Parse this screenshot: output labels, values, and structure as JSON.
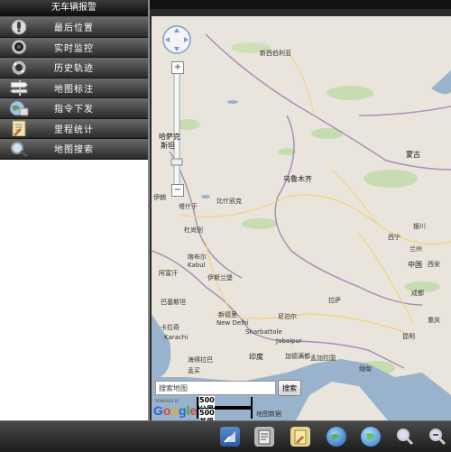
{
  "sidebar": {
    "title": "无车辆报警",
    "items": [
      {
        "label": "最后位置",
        "icon": "pin-icon"
      },
      {
        "label": "实时监控",
        "icon": "camera-icon"
      },
      {
        "label": "历史轨迹",
        "icon": "film-icon"
      },
      {
        "label": "地图标注",
        "icon": "signpost-icon"
      },
      {
        "label": "指令下发",
        "icon": "globe-icon"
      },
      {
        "label": "里程统计",
        "icon": "document-icon"
      },
      {
        "label": "地图搜索",
        "icon": "magnifier-icon"
      }
    ]
  },
  "map": {
    "search_placeholder": "搜索地图",
    "search_button": "搜索",
    "powered_by": "POWERED BY",
    "google": "Google",
    "scale_metric": "500 公里",
    "scale_imperial": "500 英里",
    "copyright": "地图数据",
    "zoom_in": "+",
    "zoom_out": "−",
    "labels": [
      "新西伯利亚",
      "哈萨克",
      "斯坦",
      "乌鲁木齐",
      "蒙古",
      "兰州",
      "中国",
      "西宁",
      "成都",
      "昆明",
      "拉萨",
      "伊斯兰堡",
      "新德里",
      "New Delhi",
      "尼泊尔",
      "加德满都",
      "印度",
      "孟加拉国",
      "孟买",
      "巴基斯坦",
      "卡拉奇",
      "阿富汗",
      "喀布尔",
      "塔什干",
      "比什凯克",
      "杜尚别",
      "伊朗",
      "银川",
      "西安",
      "重庆",
      "缅甸",
      "海得拉巴",
      "Sharbattole",
      "Jabalpur",
      "Karachi",
      "Kabul"
    ]
  },
  "bottombar": {
    "icons": [
      "map-tool-icon",
      "clipboard-icon",
      "notes-icon",
      "globe-icon",
      "globe-alt-icon",
      "zoom-icon",
      "zoom-out-icon"
    ]
  }
}
